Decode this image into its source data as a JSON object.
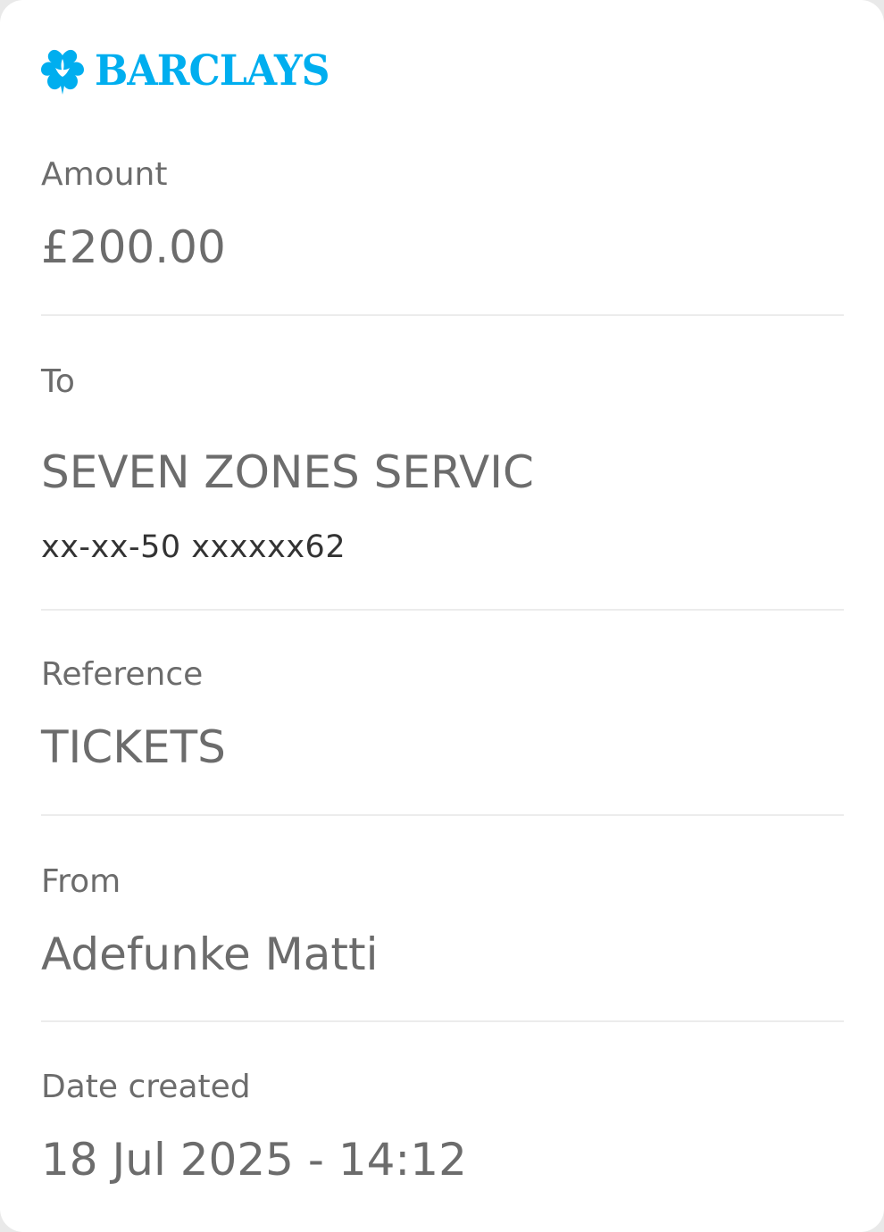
{
  "brand": {
    "name": "BARCLAYS",
    "color": "#00aeef",
    "logo_icon": "eagle-icon"
  },
  "details": {
    "amount": {
      "label": "Amount",
      "value": "£200.00"
    },
    "to": {
      "label": "To",
      "value": "SEVEN ZONES SERVIC",
      "account": "xx-xx-50 xxxxxx62"
    },
    "reference": {
      "label": "Reference",
      "value": "TICKETS"
    },
    "from": {
      "label": "From",
      "value": "Adefunke Matti"
    },
    "date_created": {
      "label": "Date created",
      "value": "18 Jul 2025 - 14:12"
    }
  },
  "colors": {
    "text": "#6c6c6c",
    "subtext": "#333333",
    "divider": "#ececec",
    "background": "#ffffff"
  }
}
